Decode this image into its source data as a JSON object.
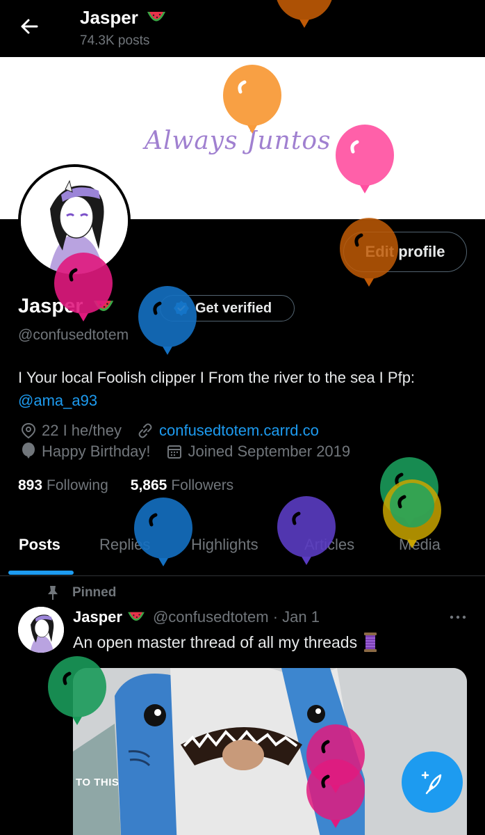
{
  "header": {
    "title": "Jasper",
    "posts_count": "74.3K posts"
  },
  "banner": {
    "text": "Always Juntos"
  },
  "profile": {
    "edit_label": "Edit profile",
    "name": "Jasper",
    "verify_label": "Get verified",
    "handle": "@confusedtotem",
    "bio_text": "I Your local Foolish clipper I From the river to the sea I Pfp:",
    "bio_mention": "@ama_a93",
    "pronouns": "22 I he/they",
    "website": "confusedtotem.carrd.co",
    "birthday": "Happy Birthday!",
    "joined": "Joined September 2019",
    "following_count": "893",
    "following_label": "Following",
    "followers_count": "5,865",
    "followers_label": "Followers"
  },
  "tabs": [
    {
      "label": "Posts"
    },
    {
      "label": "Replies"
    },
    {
      "label": "Highlights"
    },
    {
      "label": "Articles"
    },
    {
      "label": "Media"
    }
  ],
  "pinned_post": {
    "pinned_label": "Pinned",
    "author": "Jasper",
    "handle_date": "@confusedtotem · Jan 1",
    "text": "An open master thread of all my threads",
    "media_caption": "TO THIS"
  },
  "colors": {
    "accent": "#1d9bf0",
    "background": "#000000",
    "muted": "#71767b"
  },
  "icons": {
    "back": "arrow-left-icon",
    "watermelon": "watermelon-emoji-icon",
    "verified": "verified-badge-icon",
    "location": "location-pin-icon",
    "link": "link-icon",
    "balloon": "balloon-icon",
    "calendar": "calendar-icon",
    "pin": "pin-icon",
    "more": "more-dots-icon",
    "thread": "thread-spool-emoji-icon",
    "compose": "compose-post-icon"
  }
}
